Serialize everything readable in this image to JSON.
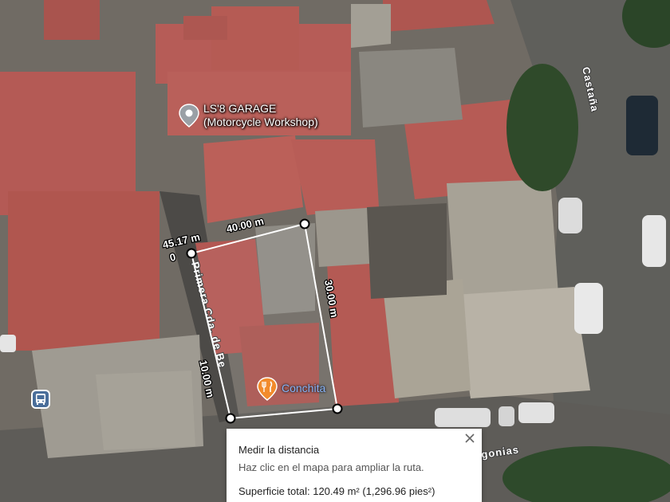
{
  "map": {
    "view": "satellite",
    "accent_color": "#ffffff"
  },
  "streets": {
    "castana": "Castaña",
    "primera_cda": "Primera Cda. de Be",
    "bottom_road": "gonias"
  },
  "places": {
    "garage_line1": "LS'8 GARAGE",
    "garage_line2": "(Motorcycle Workshop)",
    "restaurant": "Conchita"
  },
  "measure": {
    "segments": [
      "40.00 m",
      "45.17 m",
      "30.00 m",
      "10.00 m"
    ],
    "segment_0_extra": "0"
  },
  "panel": {
    "title": "Medir la distancia",
    "hint": "Haz clic en el mapa para ampliar la ruta.",
    "total": "Superficie total: 120.49 m² (1,296.96 pies²)"
  }
}
